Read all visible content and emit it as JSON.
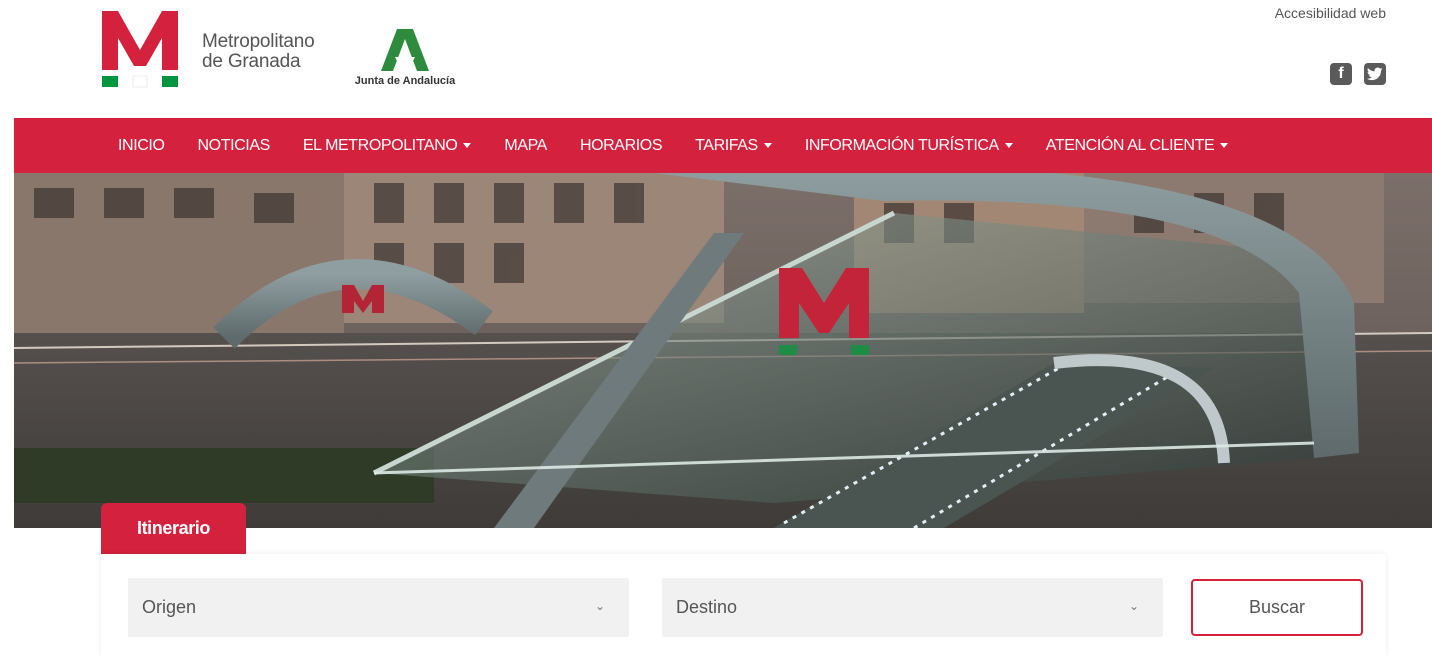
{
  "header": {
    "brand_line1": "Metropolitano",
    "brand_line2": "de Granada",
    "junta_text": "Junta de Andalucía",
    "accesibilidad": "Accesibilidad web",
    "social": {
      "facebook_glyph": "f",
      "twitter_glyph": "t"
    }
  },
  "nav": {
    "items": [
      {
        "label": "INICIO",
        "dropdown": false
      },
      {
        "label": "NOTICIAS",
        "dropdown": false
      },
      {
        "label": "EL METROPOLITANO",
        "dropdown": true
      },
      {
        "label": "MAPA",
        "dropdown": false
      },
      {
        "label": "HORARIOS",
        "dropdown": false
      },
      {
        "label": "TARIFAS",
        "dropdown": true
      },
      {
        "label": "INFORMACIÓN TURÍSTICA",
        "dropdown": true
      },
      {
        "label": "ATENCIÓN AL CLIENTE",
        "dropdown": true
      }
    ]
  },
  "itinerario": {
    "tab_label": "Itinerario",
    "origen_placeholder": "Origen",
    "destino_placeholder": "Destino",
    "buscar_label": "Buscar"
  },
  "colors": {
    "brand_red": "#d4213d",
    "brand_green": "#00963f",
    "junta_green": "#2e8b3e"
  },
  "icons": {
    "facebook": "facebook-icon",
    "twitter": "twitter-icon",
    "dropdown": "chevron-down-icon"
  }
}
